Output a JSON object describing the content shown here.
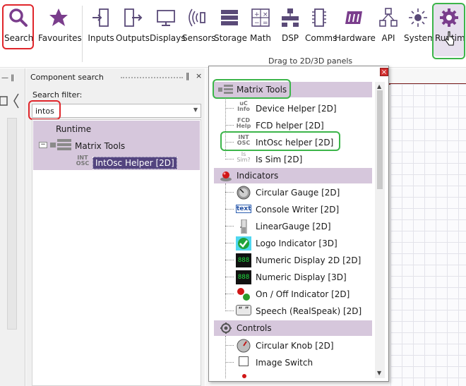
{
  "toolbar": {
    "buttons": [
      {
        "label": "Search",
        "icon": "search-icon"
      },
      {
        "label": "Favourites",
        "icon": "star-icon"
      },
      {
        "label": "Inputs",
        "icon": "input-icon"
      },
      {
        "label": "Outputs",
        "icon": "output-icon"
      },
      {
        "label": "Displays",
        "icon": "monitor-icon"
      },
      {
        "label": "Sensors",
        "icon": "sensor-icon"
      },
      {
        "label": "Storage",
        "icon": "storage-icon"
      },
      {
        "label": "Math",
        "icon": "math-icon"
      },
      {
        "label": "DSP",
        "icon": "dsp-icon"
      },
      {
        "label": "Comms",
        "icon": "chip-icon"
      },
      {
        "label": "Hardware",
        "icon": "hardware-icon"
      },
      {
        "label": "API",
        "icon": "api-icon"
      },
      {
        "label": "System",
        "icon": "sun-icon"
      },
      {
        "label": "Runtime",
        "icon": "gear-icon"
      }
    ],
    "caption": "Drag to 2D/3D panels"
  },
  "panel": {
    "title": "Component search",
    "pin": "‖",
    "close": "×",
    "filter_label": "Search filter:",
    "filter_value": "intos"
  },
  "tree": {
    "root": "Runtime",
    "group": "Matrix Tools",
    "item": "IntOsc Helper [2D]",
    "item_icon_text": [
      "INT",
      "OSC"
    ]
  },
  "popup": {
    "close": "×",
    "categories": [
      {
        "name": "Matrix Tools",
        "icon": "matrix-tools-icon",
        "items": [
          {
            "label": "Device Helper [2D]",
            "icon_text": [
              "uC",
              "Info"
            ]
          },
          {
            "label": "FCD helper [2D]",
            "icon_text": [
              "FCD",
              "Help"
            ]
          },
          {
            "label": "IntOsc helper [2D]",
            "icon_text": [
              "INT",
              "OSC"
            ]
          },
          {
            "label": "Is Sim [2D]",
            "icon_text": [
              "Is",
              "Sim?"
            ]
          }
        ]
      },
      {
        "name": "Indicators",
        "icon": "indicator-led-icon",
        "items": [
          {
            "label": "Circular Gauge [2D]",
            "icon": "gauge-icon"
          },
          {
            "label": "Console Writer [2D]",
            "icon": "text-icon",
            "icon_text": "text"
          },
          {
            "label": "LinearGauge [2D]",
            "icon": "linear-gauge-icon"
          },
          {
            "label": "Logo Indicator [3D]",
            "icon": "checkmark-icon"
          },
          {
            "label": "Numeric Display 2D [2D]",
            "icon": "seven-segment-icon",
            "icon_text": "888"
          },
          {
            "label": "Numeric Display [3D]",
            "icon": "seven-segment-icon",
            "icon_text": "888"
          },
          {
            "label": "On / Off Indicator [2D]",
            "icon": "led-icon"
          },
          {
            "label": "Speech (RealSpeak) [2D]",
            "icon": "speech-icon",
            "icon_text": "“ ”"
          }
        ]
      },
      {
        "name": "Controls",
        "icon": "controls-gear-icon",
        "items": [
          {
            "label": "Circular Knob [2D]",
            "icon": "knob-icon"
          },
          {
            "label": "Image Switch",
            "icon": "switch-icon"
          }
        ]
      }
    ]
  },
  "colors": {
    "highlight_red": "#e0262b",
    "highlight_green": "#3cb54a",
    "category_bg": "#d6c7dc",
    "selection": "#53447f",
    "brand_purple": "#7a3d8c"
  }
}
